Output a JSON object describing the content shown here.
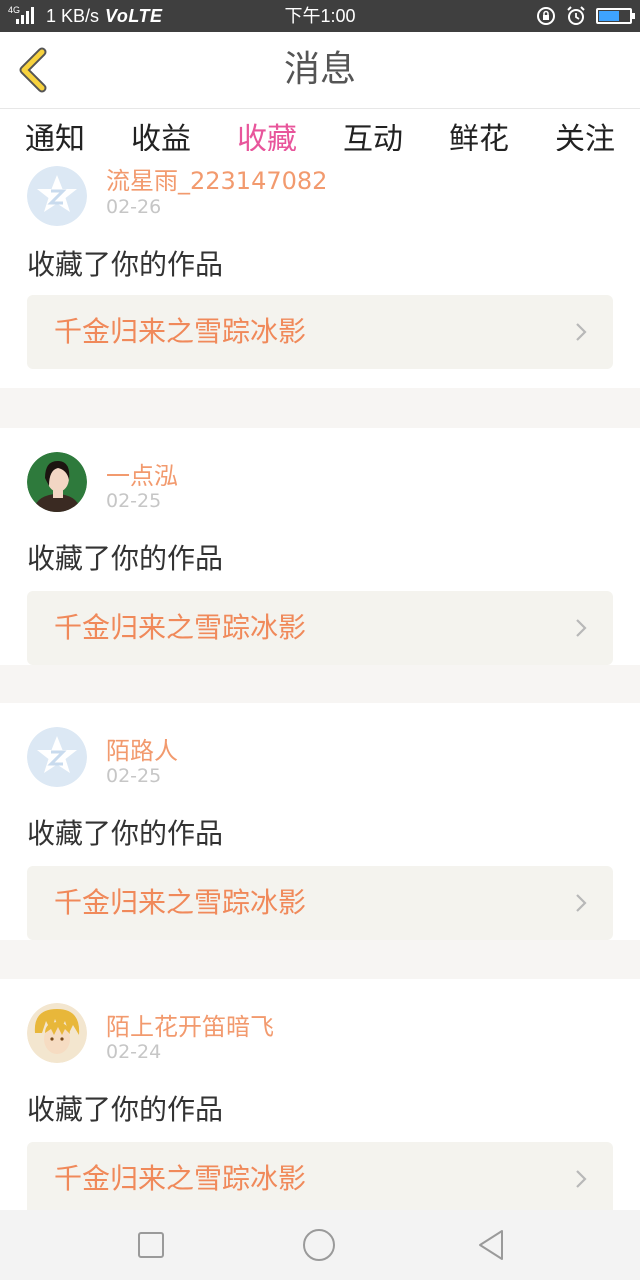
{
  "status_bar": {
    "network": "4G",
    "speed": "1 KB/s",
    "volte": "VoLTE",
    "time": "下午1:00"
  },
  "header": {
    "title": "消息",
    "back_icon": "chevron-left-icon"
  },
  "tabs": [
    {
      "label": "通知",
      "active": false
    },
    {
      "label": "收益",
      "active": false
    },
    {
      "label": "收藏",
      "active": true
    },
    {
      "label": "互动",
      "active": false
    },
    {
      "label": "鲜花",
      "active": false
    },
    {
      "label": "关注",
      "active": false
    }
  ],
  "messages": [
    {
      "username": "流星雨_223147082",
      "date": "02-26",
      "action": "收藏了你的作品",
      "work_title": "千金归来之雪踪冰影",
      "avatar": "default-star-avatar"
    },
    {
      "username": "一点泓",
      "date": "02-25",
      "action": "收藏了你的作品",
      "work_title": "千金归来之雪踪冰影",
      "avatar": "photo-avatar"
    },
    {
      "username": "陌路人",
      "date": "02-25",
      "action": "收藏了你的作品",
      "work_title": "千金归来之雪踪冰影",
      "avatar": "default-star-avatar"
    },
    {
      "username": "陌上花开笛暗飞",
      "date": "02-24",
      "action": "收藏了你的作品",
      "work_title": "千金归来之雪踪冰影",
      "avatar": "anime-avatar"
    }
  ],
  "colors": {
    "accent": "#e8559b",
    "username": "#f29a6e",
    "work_title": "#f0895a",
    "status_bar": "#3f3f3f"
  }
}
